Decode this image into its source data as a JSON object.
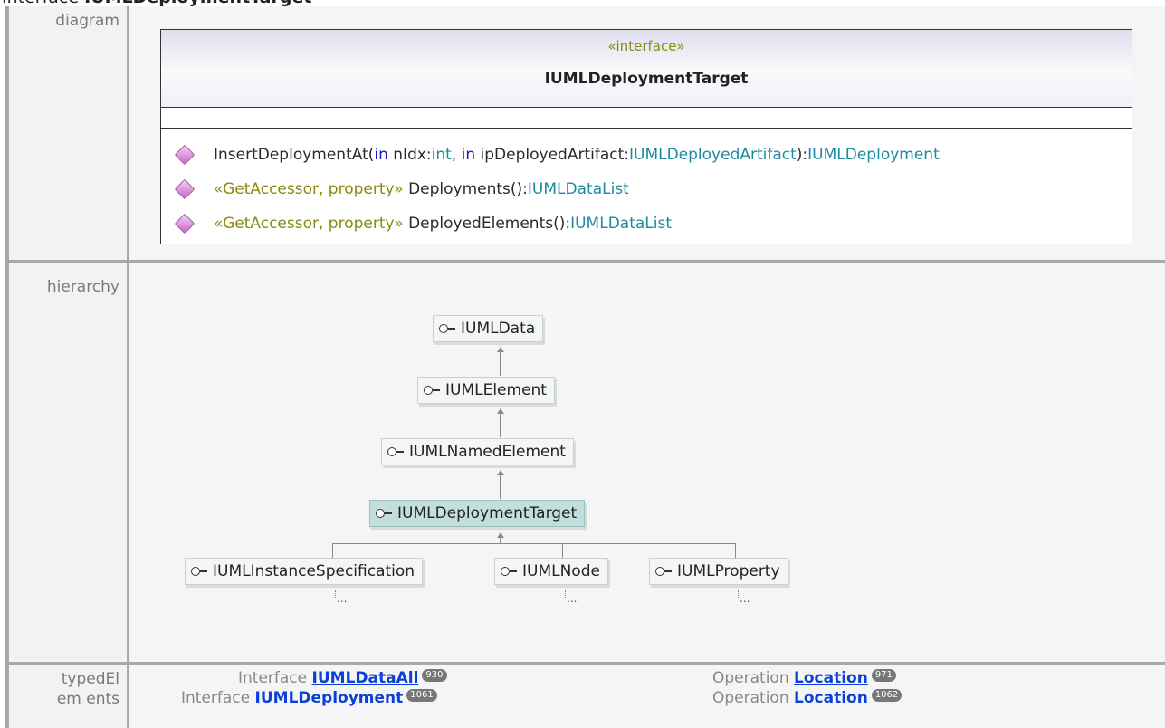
{
  "page": {
    "title_prefix": "Interface",
    "title_name": "IUMLDeploymentTarget"
  },
  "rows": {
    "diagram": "diagram",
    "hierarchy": "hierarchy",
    "typed_elements": "typedElem ents"
  },
  "uml": {
    "stereotype": "«interface»",
    "name": "IUMLDeploymentTarget",
    "operations": [
      {
        "parts": [
          {
            "t": "InsertDeploymentAt(",
            "c": "n"
          },
          {
            "t": "in",
            "c": "kw"
          },
          {
            "t": " nIdx:",
            "c": "n"
          },
          {
            "t": "int",
            "c": "ty"
          },
          {
            "t": ", ",
            "c": "n"
          },
          {
            "t": "in",
            "c": "kw"
          },
          {
            "t": " ipDeployedArtifact:",
            "c": "n"
          },
          {
            "t": "IUMLDeployedArtifact",
            "c": "ty"
          },
          {
            "t": "):",
            "c": "n"
          },
          {
            "t": "IUMLDeployment",
            "c": "ty"
          }
        ]
      },
      {
        "parts": [
          {
            "t": "«GetAccessor, property» ",
            "c": "st"
          },
          {
            "t": "Deployments():",
            "c": "n"
          },
          {
            "t": "IUMLDataList",
            "c": "ty"
          }
        ]
      },
      {
        "parts": [
          {
            "t": "«GetAccessor, property» ",
            "c": "st"
          },
          {
            "t": "DeployedElements():",
            "c": "n"
          },
          {
            "t": "IUMLDataList",
            "c": "ty"
          }
        ]
      }
    ]
  },
  "hierarchy": {
    "nodes": [
      "IUMLData",
      "IUMLElement",
      "IUMLNamedElement",
      "IUMLDeploymentTarget"
    ],
    "children": [
      "IUMLInstanceSpecification",
      "IUMLNode",
      "IUMLProperty"
    ],
    "more": "..."
  },
  "typed_elements": [
    {
      "kind": "Interface",
      "name": "IUMLDataAll",
      "count": "930"
    },
    {
      "kind": "Interface",
      "name": "IUMLDeployment",
      "count": "1061"
    },
    {
      "kind": "Operation",
      "name": "Location",
      "count": "971"
    },
    {
      "kind": "Operation",
      "name": "Location",
      "count": "1062"
    }
  ]
}
